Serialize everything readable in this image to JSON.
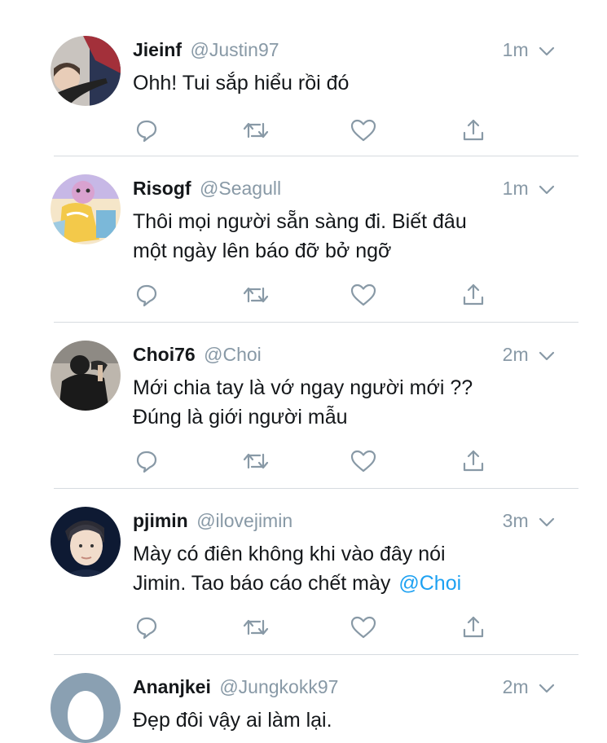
{
  "tweets": [
    {
      "name": "Jieinf",
      "handle": "@Justin97",
      "time": "1m",
      "lines": [
        "Ohh! Tui sắp hiểu rồi đó"
      ],
      "mention": ""
    },
    {
      "name": "Risogf",
      "handle": "@Seagull",
      "time": "1m",
      "lines": [
        "Thôi mọi người sẵn sàng đi. Biết đâu",
        "một ngày lên báo đỡ bở ngỡ"
      ],
      "mention": ""
    },
    {
      "name": "Choi76",
      "handle": "@Choi",
      "time": "2m",
      "lines": [
        "Mới chia tay là vớ ngay người mới ??",
        "Đúng là giới người mẫu"
      ],
      "mention": ""
    },
    {
      "name": "pjimin",
      "handle": "@ilovejimin",
      "time": "3m",
      "lines": [
        "Mày có điên không khi vào đây nói",
        "Jimin. Tao báo cáo chết mày"
      ],
      "mention": "@Choi"
    },
    {
      "name": "Ananjkei",
      "handle": "@Jungkokk97",
      "time": "2m",
      "lines": [
        "Đẹp đôi vậy ai làm lại."
      ],
      "mention": ""
    }
  ],
  "icons": [
    "reply-icon",
    "retweet-icon",
    "like-icon",
    "share-icon",
    "chevron-down-icon"
  ],
  "colors": {
    "name": "#14171a",
    "secondary": "#8899a6",
    "mention": "#1da1f2",
    "divider": "#d6dbe0",
    "icon": "#8899a6"
  }
}
